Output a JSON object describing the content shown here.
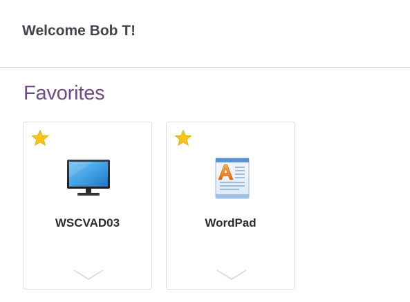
{
  "header": {
    "welcome_text": "Welcome Bob T!"
  },
  "favorites": {
    "title": "Favorites",
    "apps": [
      {
        "label": "WSCVAD03",
        "icon": "desktop-monitor-icon",
        "favorited": true
      },
      {
        "label": "WordPad",
        "icon": "wordpad-icon",
        "favorited": true
      }
    ]
  },
  "colors": {
    "section_title": "#6e4b86",
    "star": "#f5c518",
    "welcome_text": "#444450"
  }
}
